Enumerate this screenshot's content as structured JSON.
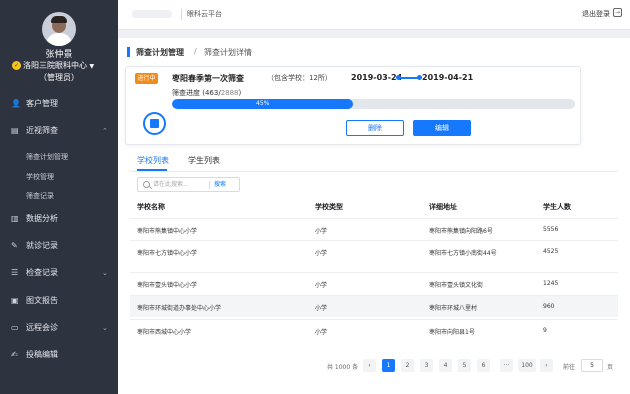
{
  "sidebar": {
    "user": {
      "name": "张仲景",
      "org": "洛阳三院眼科中心",
      "role": "（管理员）"
    },
    "menu": [
      {
        "label": "客户管理",
        "icon": "users-icon"
      },
      {
        "label": "近视筛查",
        "icon": "document-icon",
        "expanded": true,
        "children": [
          "筛查计划管理",
          "学校管理",
          "筛查记录"
        ]
      },
      {
        "label": "数据分析",
        "icon": "bar-chart-icon"
      },
      {
        "label": "就诊记录",
        "icon": "edit-icon"
      },
      {
        "label": "检查记录",
        "icon": "checklist-icon"
      },
      {
        "label": "图文报告",
        "icon": "image-icon"
      },
      {
        "label": "远程会诊",
        "icon": "monitor-icon"
      },
      {
        "label": "投稿编辑",
        "icon": "pen-icon"
      }
    ]
  },
  "topbar": {
    "brand": "眼科云平台",
    "logout": "退出登录"
  },
  "breadcrumb": {
    "level1": "筛查计划管理",
    "sep": "/",
    "level2": "筛查计划详情"
  },
  "plan": {
    "status": "进行中",
    "title": "枣阳春季第一次筛查",
    "subtitle": "（包含学校：12所）",
    "start_date": "2019-03-24",
    "end_date": "2019-04-21",
    "progress_label": "筛查进度 (463/",
    "progress_total": "2888",
    "progress_close": ")",
    "progress_fraction": 0.45,
    "progress_pct_text": "45%",
    "delete_label": "删除",
    "edit_label": "编辑"
  },
  "tabs": [
    {
      "label": "学校列表",
      "active": true
    },
    {
      "label": "学生列表",
      "active": false
    }
  ],
  "search": {
    "placeholder": "请在此搜索...",
    "button": "搜索"
  },
  "table": {
    "headers": [
      "学校名称",
      "学校类型",
      "详细地址",
      "学生人数"
    ],
    "rows": [
      [
        "枣阳市熊集镇中心小学",
        "小学",
        "枣阳市熊集镇向阳路6号",
        "5556"
      ],
      [
        "枣阳市七方镇中心小学",
        "小学",
        "枣阳市七方镇小南街44号",
        "4525"
      ],
      [
        "枣阳市壹头镇中心小学",
        "小学",
        "枣阳市壹头镇文化街",
        "1245"
      ],
      [
        "枣阳市环城街道办事处中心小学",
        "小学",
        "枣阳市环城八里村",
        "960"
      ],
      [
        "枣阳市西城中心小学",
        "小学",
        "枣阳市向阳县1号",
        "9"
      ]
    ]
  },
  "pagination": {
    "total": "共 1000 条",
    "prev": "‹",
    "pages": [
      "1",
      "2",
      "3",
      "4",
      "5",
      "6",
      "···",
      "100"
    ],
    "active": "1",
    "next": "›",
    "goto_label": "前往",
    "goto_value": "5",
    "goto_suffix": "页"
  },
  "colors": {
    "primary": "#1677ff",
    "status": "#f08c1a",
    "sidebar": "#2e3340"
  }
}
